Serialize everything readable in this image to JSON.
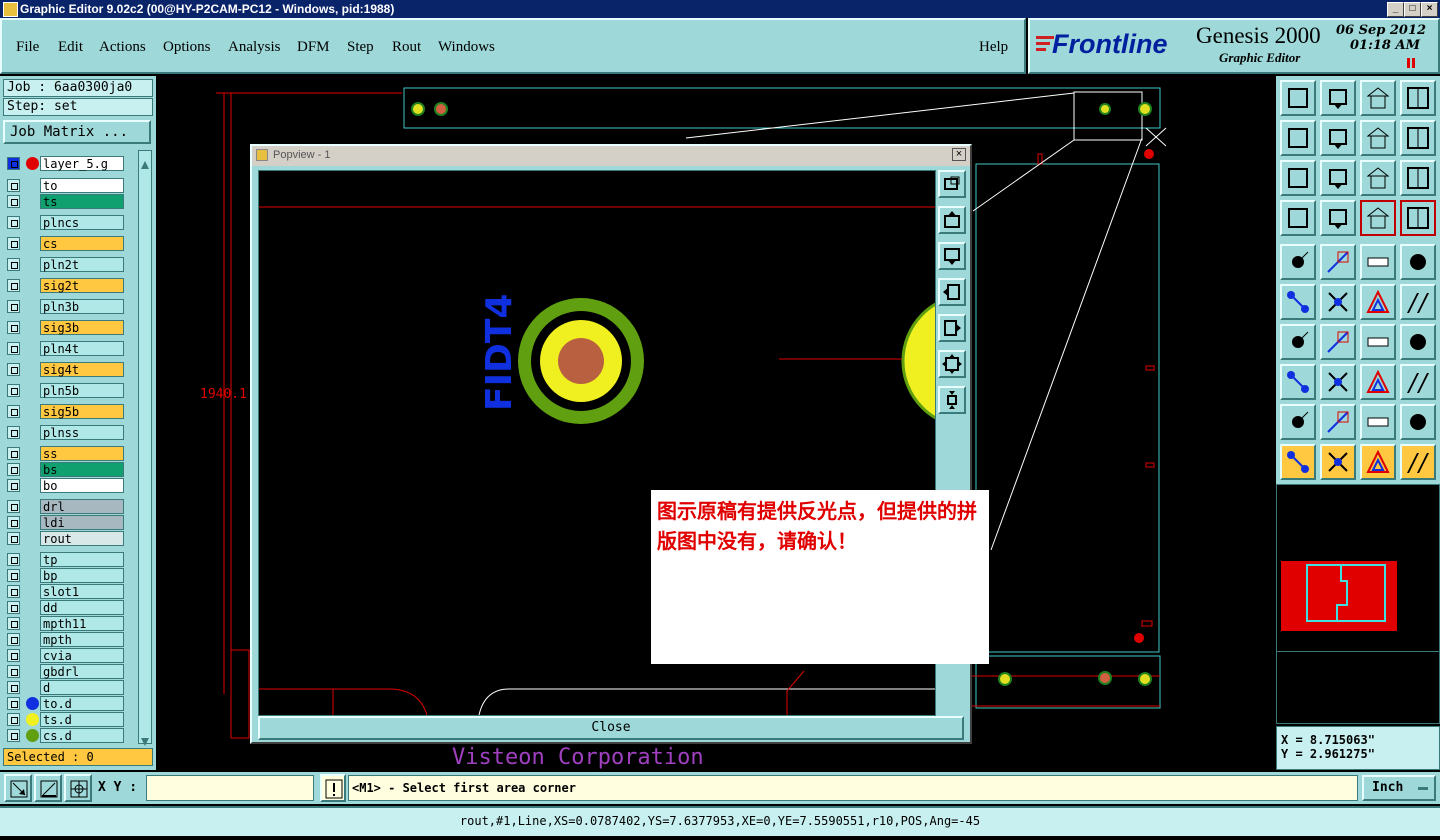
{
  "window": {
    "title": "Graphic Editor 9.02c2 (00@HY-P2CAM-PC12 - Windows, pid:1988)"
  },
  "menu": {
    "items": [
      "File",
      "Edit",
      "Actions",
      "Options",
      "Analysis",
      "DFM",
      "Step",
      "Rout",
      "Windows"
    ],
    "help": "Help"
  },
  "brand": {
    "logo": "Frontline",
    "product": "Genesis 2000",
    "subtitle": "Graphic Editor",
    "date": "06 Sep 2012",
    "time": "01:18 AM"
  },
  "job": {
    "job_label": "Job : 6aa0300ja0",
    "step_label": "Step: set",
    "matrix_button": "Job Matrix ..."
  },
  "layers": [
    {
      "name": "layer_5.g"
    },
    {
      "name": "to"
    },
    {
      "name": "ts"
    },
    {
      "name": "plncs"
    },
    {
      "name": "cs"
    },
    {
      "name": "pln2t"
    },
    {
      "name": "sig2t"
    },
    {
      "name": "pln3b"
    },
    {
      "name": "sig3b"
    },
    {
      "name": "pln4t"
    },
    {
      "name": "sig4t"
    },
    {
      "name": "pln5b"
    },
    {
      "name": "sig5b"
    },
    {
      "name": "plnss"
    },
    {
      "name": "ss"
    },
    {
      "name": "bs"
    },
    {
      "name": "bo"
    },
    {
      "name": "drl"
    },
    {
      "name": "ldi"
    },
    {
      "name": "rout"
    },
    {
      "name": "tp"
    },
    {
      "name": "bp"
    },
    {
      "name": "slot1"
    },
    {
      "name": "dd"
    },
    {
      "name": "mpth11"
    },
    {
      "name": "mpth"
    },
    {
      "name": "cvia"
    },
    {
      "name": "gbdrl"
    },
    {
      "name": "d"
    },
    {
      "name": "to.d"
    },
    {
      "name": "ts.d"
    },
    {
      "name": "cs.d"
    }
  ],
  "colors": {
    "panel": "#9ed8d8",
    "yellow_layer": "#ffc840",
    "green_layer": "#10a070",
    "white_layer": "#ffffff",
    "cyan_layer": "#b0e8e8",
    "gray_layer": "#a8b8c0"
  },
  "selected": "Selected : 0",
  "popview": {
    "title": "Popview - 1",
    "close_label": "Close",
    "fiducial_text": "FIDT4"
  },
  "canvas": {
    "dimension": "1940.1",
    "corp_text": "Visteon Corporation"
  },
  "note": {
    "text": "图示原稿有提供反光点，但提供的拼版图中没有，请确认！"
  },
  "coords": {
    "x": "X = 8.715063\"",
    "y": "Y = 2.961275\""
  },
  "command": {
    "xy_label": "X Y :",
    "xy_value": "",
    "prompt": "<M1> - Select first area corner",
    "units": "Inch"
  },
  "status": "rout,#1,Line,XS=0.0787402,YS=7.6377953,XE=0,YE=7.5590551,r10,POS,Ang=-45"
}
